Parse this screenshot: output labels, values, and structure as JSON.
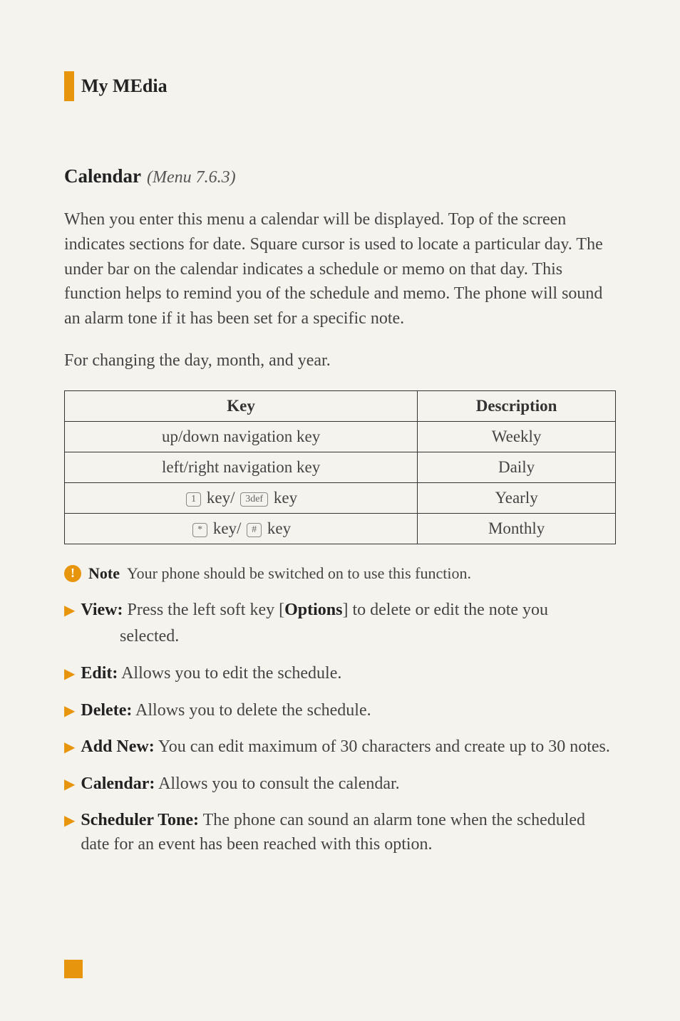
{
  "header": {
    "title": "My MEdia"
  },
  "section": {
    "title": "Calendar",
    "subtitle": "(Menu 7.6.3)"
  },
  "paragraphs": {
    "intro": "When you enter this menu a calendar will be displayed. Top of the screen indicates sections for date. Square cursor is used to locate a particular day. The under bar on the calendar indicates a schedule or memo on that day. This function helps to remind you of the schedule and memo. The phone will sound an alarm tone if it has been set for a specific note.",
    "changing": "For changing the day, month, and year."
  },
  "table": {
    "headers": {
      "key": "Key",
      "description": "Description"
    },
    "rows": [
      {
        "key": "up/down navigation key",
        "desc": "Weekly"
      },
      {
        "key": "left/right navigation key",
        "desc": "Daily"
      },
      {
        "key_prefix": "key/",
        "key_suffix": "key",
        "icon1": "1",
        "icon2": "3def",
        "desc": "Yearly"
      },
      {
        "key_prefix": "key/",
        "key_suffix": "key",
        "icon1": "*",
        "icon2": "#",
        "desc": "Monthly"
      }
    ]
  },
  "note": {
    "label": "Note",
    "text": "Your phone should be switched on to use this function."
  },
  "bullets": [
    {
      "title": "View:",
      "text_before": "Press the left soft key [",
      "text_bold": "Options",
      "text_after": "] to delete or edit the note you",
      "text_line2": "selected."
    },
    {
      "title": "Edit:",
      "text": " Allows you to edit the schedule."
    },
    {
      "title": "Delete:",
      "text": " Allows you to delete the schedule."
    },
    {
      "title": "Add New:",
      "text": " You can edit maximum of 30 characters and create up to 30 notes."
    },
    {
      "title": "Calendar:",
      "text": " Allows you to consult the calendar."
    },
    {
      "title": "Scheduler Tone:",
      "text": " The phone can sound an alarm tone when the scheduled date for an event has been reached with this option."
    }
  ]
}
